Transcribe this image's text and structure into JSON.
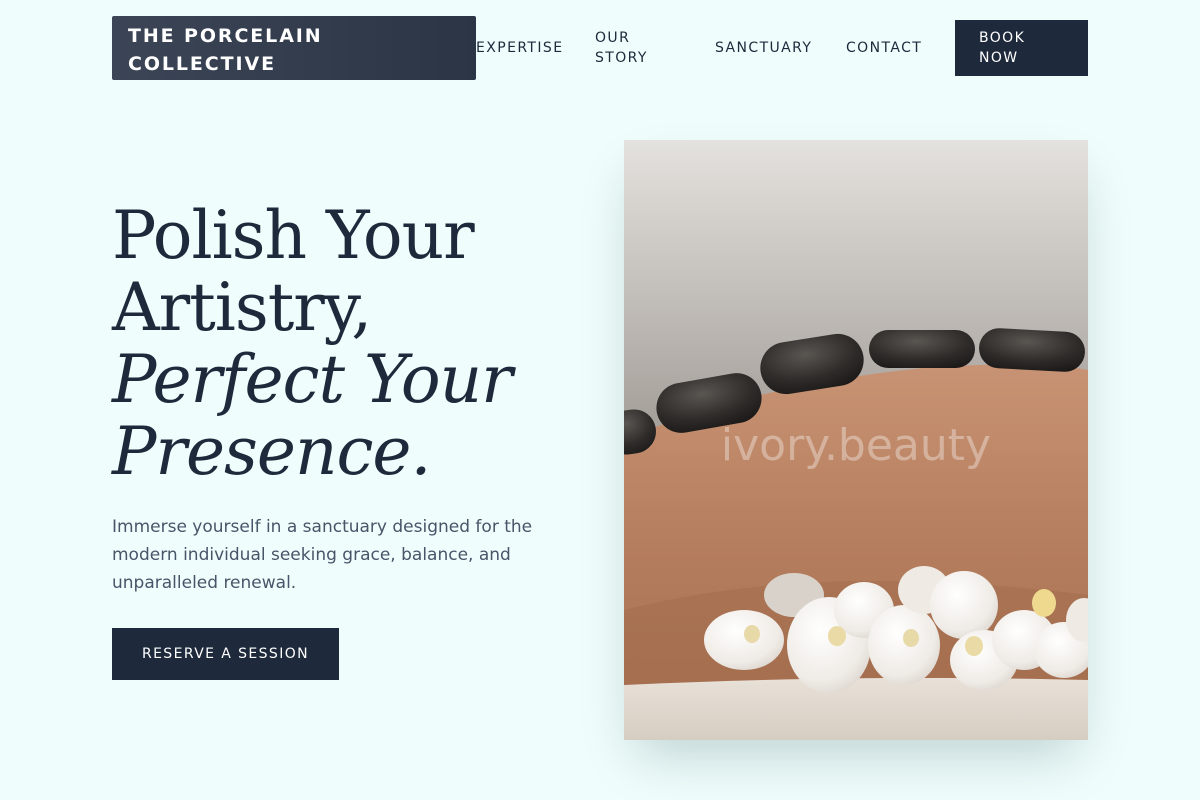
{
  "header": {
    "logo_line1": "THE PORCELAIN",
    "logo_line2": "COLLECTIVE",
    "nav": {
      "expertise": "EXPERTISE",
      "story_line1": "OUR",
      "story_line2": "STORY",
      "sanctuary": "SANCTUARY",
      "contact": "CONTACT"
    },
    "book_line1": "BOOK",
    "book_line2": "NOW"
  },
  "hero": {
    "title_line1": "Polish Your",
    "title_line2": "Artistry,",
    "title_line3": "Perfect Your",
    "title_line4": "Presence.",
    "description": "Immerse yourself in a sanctuary designed for the modern individual seeking grace, balance, and unparalleled renewal.",
    "cta_label": "RESERVE A SESSION",
    "image_watermark": "ivory.beauty"
  },
  "colors": {
    "background": "#effdfc",
    "primary_dark": "#1e293b",
    "body_text": "#475569",
    "logo_bg": "#334155"
  }
}
